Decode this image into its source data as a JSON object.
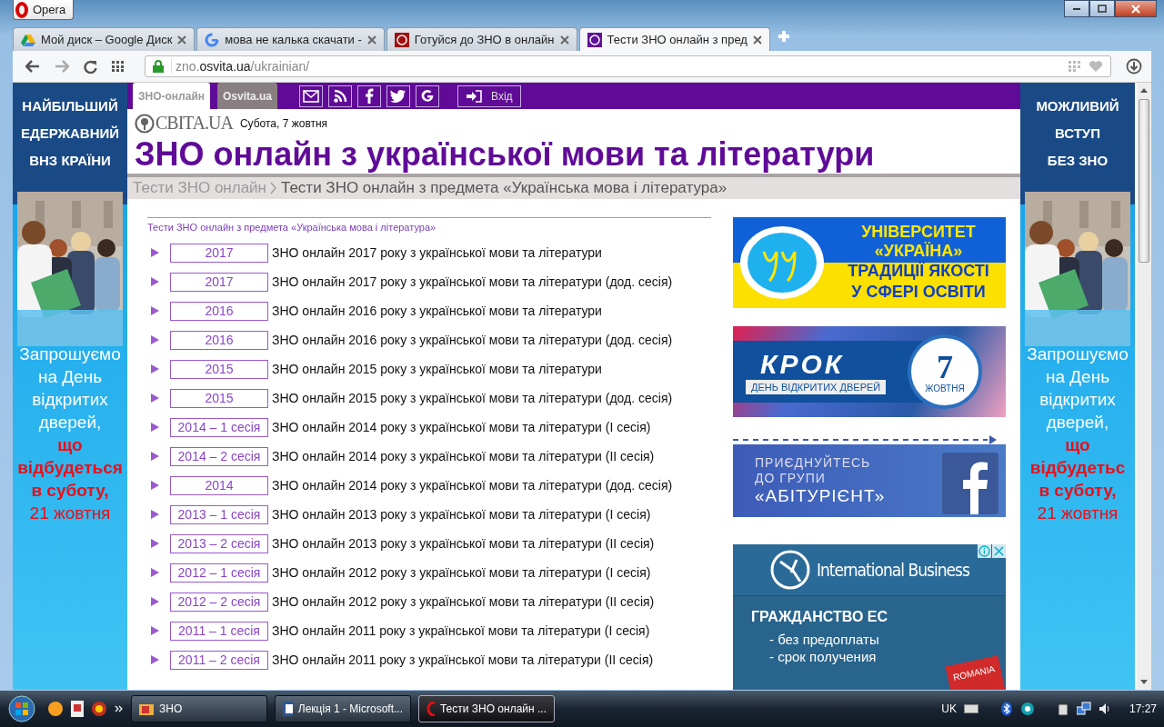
{
  "window": {
    "app_button": "Opera"
  },
  "tabs": [
    {
      "label": "Мой диск – Google Диск",
      "selected": false
    },
    {
      "label": "мова не калька скачати -",
      "selected": false
    },
    {
      "label": "Готуйся до ЗНО в онлайн",
      "selected": false
    },
    {
      "label": "Тести ЗНО онлайн з пред",
      "selected": true
    }
  ],
  "address_bar": {
    "prefix": "zno.",
    "domain": "osvita.ua",
    "path": "/ukrainian/"
  },
  "left_banner": {
    "heading": [
      "НАЙБІЛЬШИЙ",
      "ЕДЕРЖАВНИЙ",
      "ВНЗ КРАЇНИ"
    ],
    "lines": [
      {
        "text": "Запрошуємо",
        "kind": "white"
      },
      {
        "text": "на День",
        "kind": "white"
      },
      {
        "text": "відкритих",
        "kind": "white"
      },
      {
        "text": "дверей,",
        "kind": "white"
      },
      {
        "text": "що",
        "kind": "red"
      },
      {
        "text": "відбудеться",
        "kind": "red"
      },
      {
        "text": "в суботу,",
        "kind": "red"
      },
      {
        "text": "21 жовтня",
        "kind": "date"
      }
    ]
  },
  "right_banner": {
    "heading": [
      "МОЖЛИВИЙ",
      "ВСТУП",
      "БЕЗ ЗНО"
    ],
    "lines": [
      {
        "text": "Запрошуємо",
        "kind": "white"
      },
      {
        "text": "на День",
        "kind": "white"
      },
      {
        "text": "відкритих",
        "kind": "white"
      },
      {
        "text": "дверей,",
        "kind": "white"
      },
      {
        "text": "що",
        "kind": "red"
      },
      {
        "text": "відбудетьс",
        "kind": "red"
      },
      {
        "text": "в суботу,",
        "kind": "red"
      },
      {
        "text": "21 жовтня",
        "kind": "date"
      }
    ]
  },
  "site_tabs": [
    {
      "label": "ЗНО-онлайн",
      "selected": true
    },
    {
      "label": "Osvita.ua",
      "selected": false
    }
  ],
  "login": "Вхід",
  "logo": "СВІТА.UA",
  "date": "Субота, 7 жовтня",
  "title": "ЗНО онлайн з української мови та літератури",
  "breadcrumb": [
    {
      "text": "Тести ЗНО онлайн",
      "kind": "link"
    },
    {
      "text": "Тести ЗНО онлайн з предмета «Українська мова і література»",
      "kind": "current"
    }
  ],
  "section_title": "Тести ЗНО онлайн з предмета «Українська мова і література»",
  "tests": [
    {
      "year": "2017",
      "title": "ЗНО онлайн 2017 року з української мови та літератури"
    },
    {
      "year": "2017",
      "title": "ЗНО онлайн 2017 року з української мови та літератури (дод. сесія)"
    },
    {
      "year": "2016",
      "title": "ЗНО онлайн 2016 року з української мови та літератури"
    },
    {
      "year": "2016",
      "title": "ЗНО онлайн 2016 року з української мови та літератури (дод. сесія)"
    },
    {
      "year": "2015",
      "title": "ЗНО онлайн 2015 року з української мови та літератури"
    },
    {
      "year": "2015",
      "title": "ЗНО онлайн 2015 року з української мови та літератури (дод. сесія)"
    },
    {
      "year": "2014 – 1 сесія",
      "title": "ЗНО онлайн 2014 року з української мови та літератури (I сесія)"
    },
    {
      "year": "2014 – 2 сесія",
      "title": "ЗНО онлайн 2014 року з української мови та літератури (II сесія)"
    },
    {
      "year": "2014",
      "title": "ЗНО онлайн 2014 року з української мови та літератури (дод. сесія)"
    },
    {
      "year": "2013 – 1 сесія",
      "title": "ЗНО онлайн 2013 року з української мови та літератури (I сесія)"
    },
    {
      "year": "2013 – 2 сесія",
      "title": "ЗНО онлайн 2013 року з української мови та літератури (II сесія)"
    },
    {
      "year": "2012 – 1 сесія",
      "title": "ЗНО онлайн 2012 року з української мови та літератури (I сесія)"
    },
    {
      "year": "2012 – 2 сесія",
      "title": "ЗНО онлайн 2012 року з української мови та літератури (II сесія)"
    },
    {
      "year": "2011 – 1 сесія",
      "title": "ЗНО онлайн 2011 року з української мови та літератури (I сесія)"
    },
    {
      "year": "2011 – 2 сесія",
      "title": "ЗНО онлайн 2011 року з української мови та літератури (II сесія)"
    }
  ],
  "ads": [
    {
      "kind": "university",
      "lines": [
        "УНІВЕРСИТЕТ",
        "«УКРАЇНА»",
        "ТРАДИЦІЇ ЯКОСТІ",
        "У СФЕРІ ОСВІТИ"
      ]
    },
    {
      "kind": "krok",
      "lines": [
        "КРОК",
        "ДЕНЬ ВІДКРИТИХ ДВЕРЕЙ",
        "7",
        "ЖОВТНЯ"
      ]
    },
    {
      "kind": "facebook",
      "lines": [
        "ПРИЄДНУЙТЕСЬ",
        "ДО ГРУПИ",
        "«АБІТУРІЄНТ»"
      ]
    },
    {
      "kind": "business",
      "lines": [
        "International Business",
        "ГРАЖДАНСТВО ЕС",
        "- без предоплаты",
        "- срок получения",
        "ROMANIA"
      ]
    }
  ],
  "taskbar": {
    "buttons": [
      {
        "label": "ЗНО",
        "selected": false
      },
      {
        "label": "Лекція 1 - Microsoft...",
        "selected": false
      },
      {
        "label": "Тести ЗНО онлайн ...",
        "selected": true
      }
    ],
    "language": "UK",
    "clock": "17:27"
  }
}
